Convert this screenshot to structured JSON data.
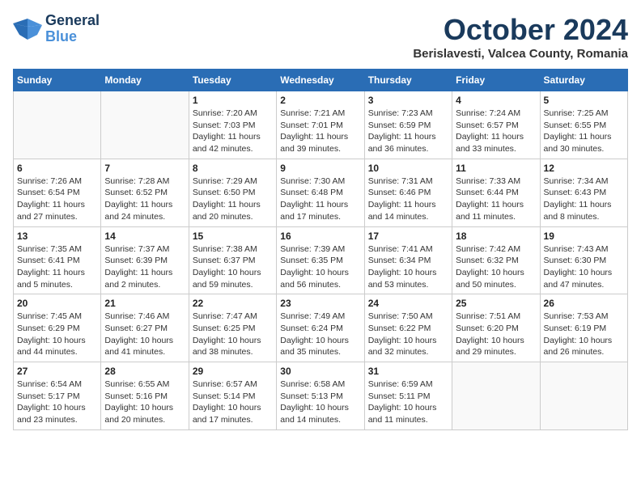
{
  "header": {
    "logo": {
      "line1": "General",
      "line2": "Blue"
    },
    "title": "October 2024",
    "subtitle": "Berislavesti, Valcea County, Romania"
  },
  "calendar": {
    "days_of_week": [
      "Sunday",
      "Monday",
      "Tuesday",
      "Wednesday",
      "Thursday",
      "Friday",
      "Saturday"
    ],
    "weeks": [
      [
        {
          "day": "",
          "info": ""
        },
        {
          "day": "",
          "info": ""
        },
        {
          "day": "1",
          "info": "Sunrise: 7:20 AM\nSunset: 7:03 PM\nDaylight: 11 hours and 42 minutes."
        },
        {
          "day": "2",
          "info": "Sunrise: 7:21 AM\nSunset: 7:01 PM\nDaylight: 11 hours and 39 minutes."
        },
        {
          "day": "3",
          "info": "Sunrise: 7:23 AM\nSunset: 6:59 PM\nDaylight: 11 hours and 36 minutes."
        },
        {
          "day": "4",
          "info": "Sunrise: 7:24 AM\nSunset: 6:57 PM\nDaylight: 11 hours and 33 minutes."
        },
        {
          "day": "5",
          "info": "Sunrise: 7:25 AM\nSunset: 6:55 PM\nDaylight: 11 hours and 30 minutes."
        }
      ],
      [
        {
          "day": "6",
          "info": "Sunrise: 7:26 AM\nSunset: 6:54 PM\nDaylight: 11 hours and 27 minutes."
        },
        {
          "day": "7",
          "info": "Sunrise: 7:28 AM\nSunset: 6:52 PM\nDaylight: 11 hours and 24 minutes."
        },
        {
          "day": "8",
          "info": "Sunrise: 7:29 AM\nSunset: 6:50 PM\nDaylight: 11 hours and 20 minutes."
        },
        {
          "day": "9",
          "info": "Sunrise: 7:30 AM\nSunset: 6:48 PM\nDaylight: 11 hours and 17 minutes."
        },
        {
          "day": "10",
          "info": "Sunrise: 7:31 AM\nSunset: 6:46 PM\nDaylight: 11 hours and 14 minutes."
        },
        {
          "day": "11",
          "info": "Sunrise: 7:33 AM\nSunset: 6:44 PM\nDaylight: 11 hours and 11 minutes."
        },
        {
          "day": "12",
          "info": "Sunrise: 7:34 AM\nSunset: 6:43 PM\nDaylight: 11 hours and 8 minutes."
        }
      ],
      [
        {
          "day": "13",
          "info": "Sunrise: 7:35 AM\nSunset: 6:41 PM\nDaylight: 11 hours and 5 minutes."
        },
        {
          "day": "14",
          "info": "Sunrise: 7:37 AM\nSunset: 6:39 PM\nDaylight: 11 hours and 2 minutes."
        },
        {
          "day": "15",
          "info": "Sunrise: 7:38 AM\nSunset: 6:37 PM\nDaylight: 10 hours and 59 minutes."
        },
        {
          "day": "16",
          "info": "Sunrise: 7:39 AM\nSunset: 6:35 PM\nDaylight: 10 hours and 56 minutes."
        },
        {
          "day": "17",
          "info": "Sunrise: 7:41 AM\nSunset: 6:34 PM\nDaylight: 10 hours and 53 minutes."
        },
        {
          "day": "18",
          "info": "Sunrise: 7:42 AM\nSunset: 6:32 PM\nDaylight: 10 hours and 50 minutes."
        },
        {
          "day": "19",
          "info": "Sunrise: 7:43 AM\nSunset: 6:30 PM\nDaylight: 10 hours and 47 minutes."
        }
      ],
      [
        {
          "day": "20",
          "info": "Sunrise: 7:45 AM\nSunset: 6:29 PM\nDaylight: 10 hours and 44 minutes."
        },
        {
          "day": "21",
          "info": "Sunrise: 7:46 AM\nSunset: 6:27 PM\nDaylight: 10 hours and 41 minutes."
        },
        {
          "day": "22",
          "info": "Sunrise: 7:47 AM\nSunset: 6:25 PM\nDaylight: 10 hours and 38 minutes."
        },
        {
          "day": "23",
          "info": "Sunrise: 7:49 AM\nSunset: 6:24 PM\nDaylight: 10 hours and 35 minutes."
        },
        {
          "day": "24",
          "info": "Sunrise: 7:50 AM\nSunset: 6:22 PM\nDaylight: 10 hours and 32 minutes."
        },
        {
          "day": "25",
          "info": "Sunrise: 7:51 AM\nSunset: 6:20 PM\nDaylight: 10 hours and 29 minutes."
        },
        {
          "day": "26",
          "info": "Sunrise: 7:53 AM\nSunset: 6:19 PM\nDaylight: 10 hours and 26 minutes."
        }
      ],
      [
        {
          "day": "27",
          "info": "Sunrise: 6:54 AM\nSunset: 5:17 PM\nDaylight: 10 hours and 23 minutes."
        },
        {
          "day": "28",
          "info": "Sunrise: 6:55 AM\nSunset: 5:16 PM\nDaylight: 10 hours and 20 minutes."
        },
        {
          "day": "29",
          "info": "Sunrise: 6:57 AM\nSunset: 5:14 PM\nDaylight: 10 hours and 17 minutes."
        },
        {
          "day": "30",
          "info": "Sunrise: 6:58 AM\nSunset: 5:13 PM\nDaylight: 10 hours and 14 minutes."
        },
        {
          "day": "31",
          "info": "Sunrise: 6:59 AM\nSunset: 5:11 PM\nDaylight: 10 hours and 11 minutes."
        },
        {
          "day": "",
          "info": ""
        },
        {
          "day": "",
          "info": ""
        }
      ]
    ]
  }
}
